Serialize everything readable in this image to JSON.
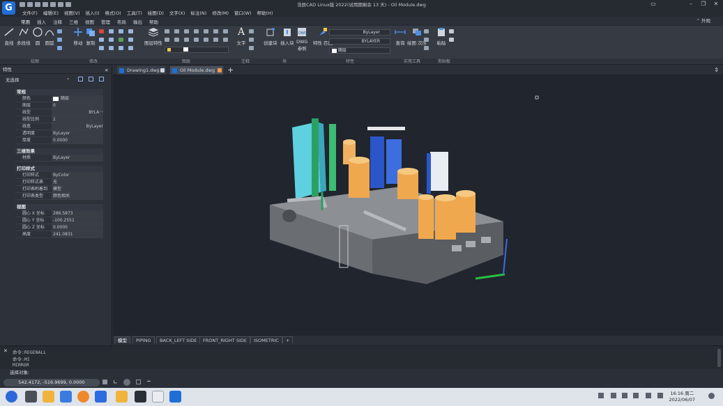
{
  "app": {
    "title": "浩辰CAD Linux版 2022(试用期剩余 13 天) - Oil Module.dwg",
    "logo": "G"
  },
  "menu": [
    "文件(F)",
    "编辑(E)",
    "视图(V)",
    "插入(I)",
    "格式(O)",
    "工具(T)",
    "绘图(D)",
    "文字(X)",
    "标注(N)",
    "修改(M)",
    "窗口(W)",
    "帮助(H)"
  ],
  "ribbon_tabs": {
    "items": [
      "常用",
      "插入",
      "注释",
      "三维",
      "视图",
      "管理",
      "布局",
      "输出",
      "帮助"
    ],
    "active": "常用",
    "extra": "外观"
  },
  "ribbon": {
    "draw": {
      "line": "直线",
      "polyline": "多段线",
      "circle": "圆",
      "arc": "圆弧"
    },
    "modify": {
      "move": "移动",
      "copy": "复制"
    },
    "layer": {
      "props": "图层特性"
    },
    "annot": {
      "text": "文字"
    },
    "block": {
      "create": "创建块",
      "insert": "插入块",
      "dwg": "DWG\n参照"
    },
    "props": {
      "match": "特性 匹配",
      "bylayer1": "ByLayer",
      "bylayer2": "BYLAYER",
      "layer": "随层"
    },
    "util": {
      "query": "查询",
      "draworder": "绘图 次序"
    },
    "clip": {
      "paste": "粘贴"
    }
  },
  "panel_names": [
    "绘图",
    "修改",
    "图层",
    "注释",
    "块",
    "特性",
    "实用工具",
    "剪贴板"
  ],
  "properties": {
    "header": "特性",
    "selection": "无选择",
    "groups": [
      {
        "title": "常规",
        "rows": [
          {
            "k": "颜色",
            "v": "随层"
          },
          {
            "k": "图层",
            "v": "0"
          },
          {
            "k": "线型",
            "v": "BYLA···"
          },
          {
            "k": "线型比例",
            "v": "1"
          },
          {
            "k": "线宽",
            "v": "ByLayer"
          },
          {
            "k": "透明度",
            "v": "ByLayer"
          },
          {
            "k": "厚度",
            "v": "0.0000"
          }
        ]
      },
      {
        "title": "三维效果",
        "rows": [
          {
            "k": "材质",
            "v": "ByLayer"
          }
        ]
      },
      {
        "title": "打印样式",
        "rows": [
          {
            "k": "打印样式",
            "v": "ByColor"
          },
          {
            "k": "打印样式表",
            "v": "无"
          },
          {
            "k": "打印表附着到",
            "v": "模型"
          },
          {
            "k": "打印表类型",
            "v": "颜色相关"
          }
        ]
      },
      {
        "title": "视图",
        "rows": [
          {
            "k": "圆心 X 坐标",
            "v": "286.5873"
          },
          {
            "k": "圆心 Y 坐标",
            "v": "-100.2551"
          },
          {
            "k": "圆心 Z 坐标",
            "v": "0.0000"
          },
          {
            "k": "高度",
            "v": "241.0831"
          }
        ]
      }
    ]
  },
  "doc_tabs": [
    "Drawing1.dwg",
    "Oil Module.dwg"
  ],
  "layout_tabs": [
    "模型",
    "PIPING",
    "BACK_LEFT SIDE",
    "FRONT_RIGHT SIDE",
    "ISOMETRIC",
    "+"
  ],
  "command": {
    "lines": [
      "命令:REGENALL",
      "命令:MI",
      "MIRROR"
    ],
    "prompt": "选择对象:"
  },
  "status": {
    "coords": "542.4172, -516.9699, 0.0000"
  },
  "taskbar": {
    "time": "16:16 周二",
    "date": "2022/06/07"
  },
  "colors": {
    "accent": "#1f6fd6",
    "viewport": "#20252e",
    "panel": "#2d3139"
  }
}
